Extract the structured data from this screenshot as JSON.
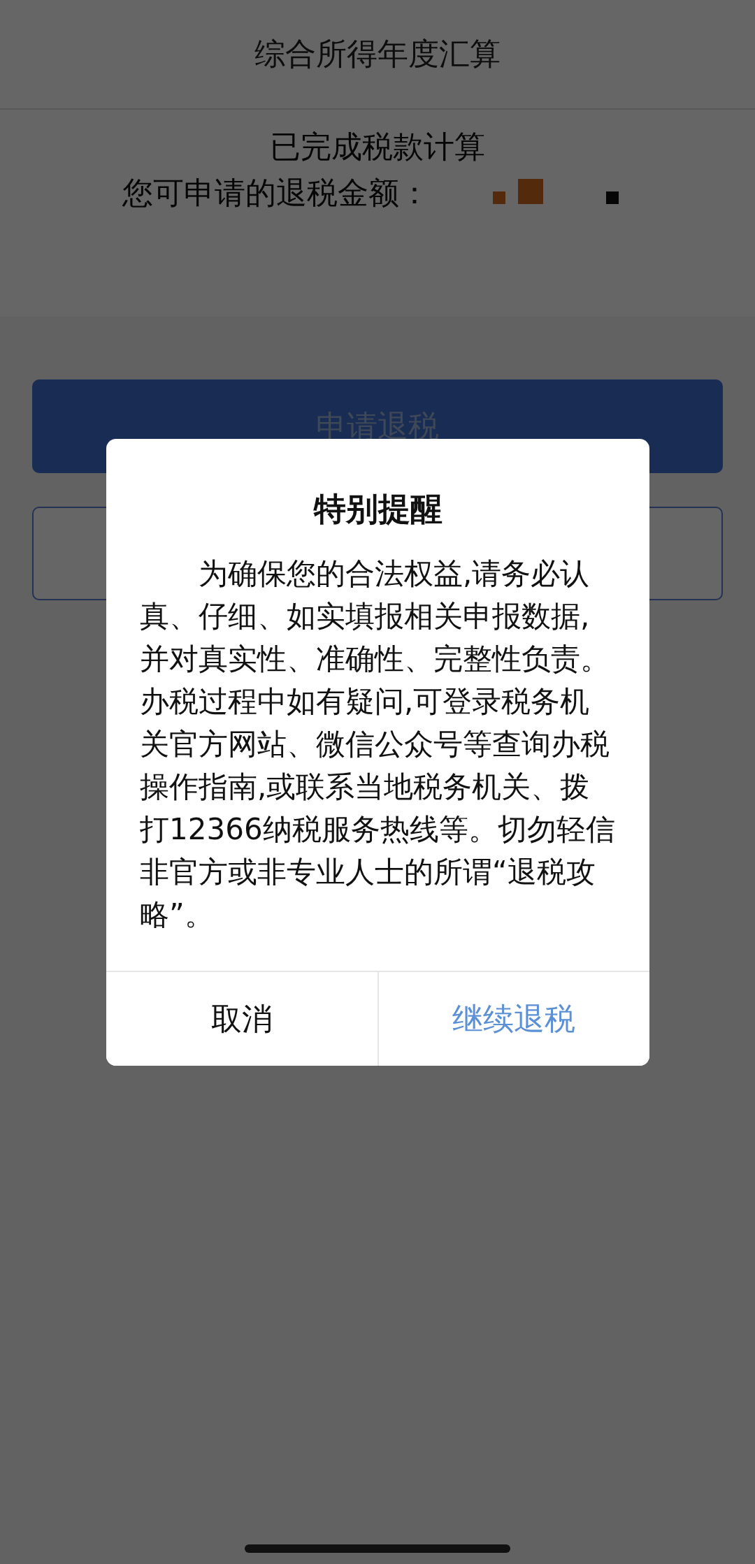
{
  "header": {
    "title": "综合所得年度汇算"
  },
  "result": {
    "status": "已完成税款计算",
    "amount_label": "您可申请的退税金额："
  },
  "apply_button": {
    "label": "申请退税"
  },
  "dialog": {
    "title": "特别提醒",
    "body": "为确保您的合法权益,请务必认真、仔细、如实填报相关申报数据,并对真实性、准确性、完整性负责。办税过程中如有疑问,可登录税务机关官方网站、微信公众号等查询办税操作指南,或联系当地税务机关、拨打12366纳税服务热线等。切勿轻信非官方或非专业人士的所谓“退税攻略”。",
    "buttons": [
      {
        "label": "取消",
        "kind": "cancel"
      },
      {
        "label": "继续退税",
        "kind": "confirm"
      }
    ]
  }
}
